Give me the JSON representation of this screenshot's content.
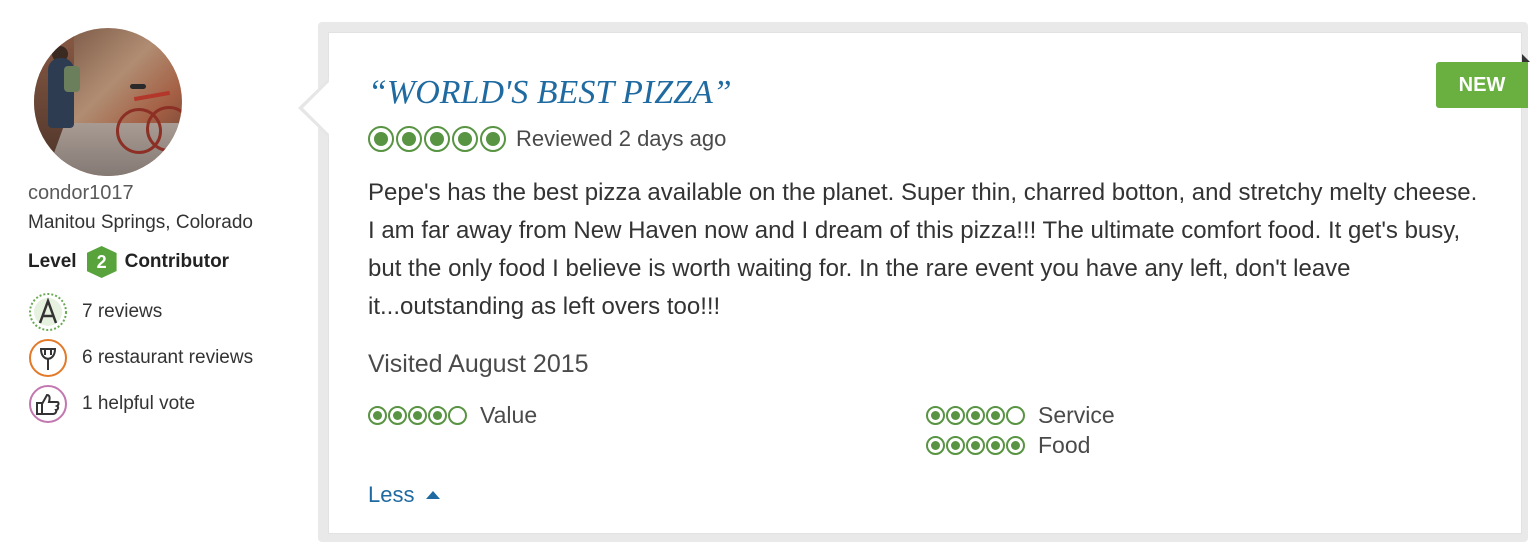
{
  "reviewer": {
    "username": "condor1017",
    "location": "Manitou Springs, Colorado",
    "level_prefix": "Level",
    "level_number": "2",
    "level_suffix": "Contributor",
    "stats": [
      {
        "icon": "review-icon",
        "text": "7 reviews",
        "color": "#6aaa53"
      },
      {
        "icon": "restaurant-icon",
        "text": "6 restaurant reviews",
        "color": "#e27a2a"
      },
      {
        "icon": "thumbs-up-icon",
        "text": "1 helpful vote",
        "color": "#c277b0"
      }
    ]
  },
  "review": {
    "badge": "NEW",
    "title": "“WORLD'S BEST PIZZA”",
    "overall_rating": 5,
    "overall_rating_max": 5,
    "reviewed_text": "Reviewed 2 days ago",
    "body": "Pepe's has the best pizza available on the planet. Super thin, charred botton, and stretchy melty cheese. I am far away from New Haven now and I dream of this pizza!!! The ultimate comfort food. It get's busy, but the only food I believe is worth waiting for. In the rare event you have any left, don't leave it...outstanding as left overs too!!!",
    "visited": "Visited August 2015",
    "subratings": [
      {
        "label": "Value",
        "rating": 4,
        "max": 5
      },
      {
        "label": "Service",
        "rating": 4,
        "max": 5
      },
      {
        "label": "Food",
        "rating": 5,
        "max": 5
      }
    ],
    "less_label": "Less"
  },
  "colors": {
    "title": "#1f6aa0",
    "bubble": "#589442",
    "badge": "#6ab040",
    "level_badge": "#58a33b",
    "link": "#1f6aa0"
  }
}
